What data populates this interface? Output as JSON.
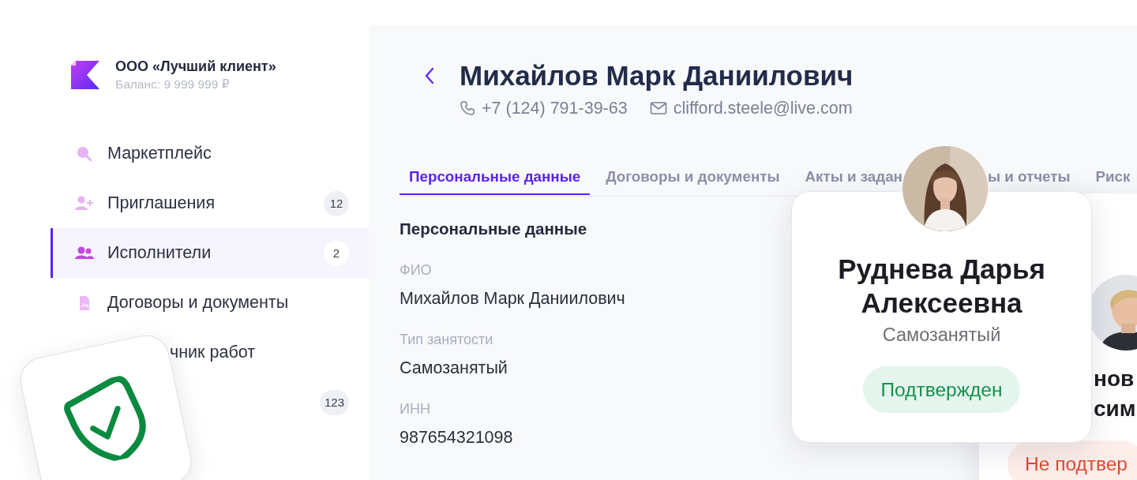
{
  "sidebar": {
    "company": "ООО «Лучший клиент»",
    "balance": "Баланс: 9 999 999 ₽",
    "items": [
      {
        "label": "Маркетплейс",
        "selected": false
      },
      {
        "label": "Приглашения",
        "badge": "12",
        "selected": false
      },
      {
        "label": "Исполнители",
        "badge": "2",
        "selected": true
      },
      {
        "label": "Договоры и документы",
        "selected": false
      },
      {
        "label": "чник работ",
        "selected": false,
        "kind": "covered"
      },
      {
        "badge": "123",
        "selected": false,
        "kind": "covered"
      }
    ]
  },
  "profile": {
    "name": "Михайлов Марк Даниилович",
    "phone": "+7 (124) 791-39-63",
    "email": "clifford.steele@live.com"
  },
  "tabs": [
    {
      "label": "Персональные данные",
      "selected": true
    },
    {
      "label": "Договоры и документы",
      "selected": false
    },
    {
      "label": "Акты и задан",
      "selected": false,
      "kind": "cut"
    },
    {
      "label": "ы и отчеты",
      "selected": false,
      "kind": "fragment"
    },
    {
      "label": "Риск",
      "selected": false
    }
  ],
  "section": {
    "title": "Персональные данные",
    "fields": [
      {
        "label": "ФИО",
        "value": "Михайлов Марк Даниилович"
      },
      {
        "label": "Тип занятости",
        "value": "Самозанятый"
      },
      {
        "label": "ИНН",
        "value": "987654321098"
      }
    ]
  },
  "cards": [
    {
      "kind": "back",
      "name_lines": [
        "нов",
        "сим"
      ],
      "status": {
        "label": "Не подтвер",
        "kind": "unconfirmed"
      }
    },
    {
      "kind": "front",
      "name": "Руднева Дарья Алексеевна",
      "role": "Самозанятый",
      "status": {
        "label": "Подтвержден",
        "kind": "confirmed"
      }
    }
  ]
}
